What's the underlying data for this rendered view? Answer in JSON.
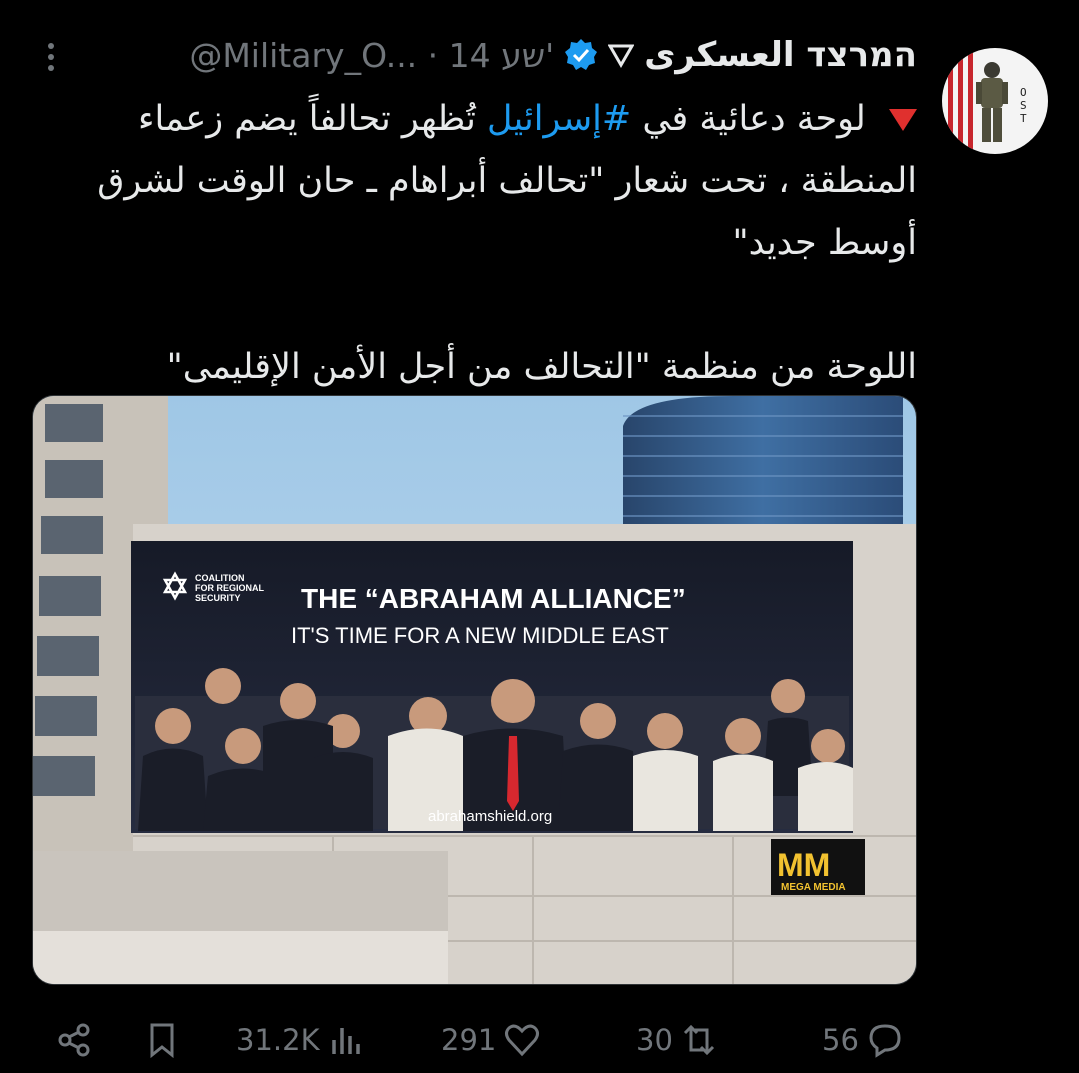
{
  "header": {
    "name": "המרצד العسكرى",
    "handle": "@Military_O... · 14 שע'"
  },
  "tweet": {
    "line1_before": "لوحة دعائية في",
    "hashtag": "#إسرائيل",
    "line1_after": "تُظهر تحالفاً يضم زعماء",
    "line2": "المنطقة ، تحت شعار \"تحالف أبراهام ـ حان الوقت لشرق",
    "line3": "أوسط جديد\"",
    "line5": "اللوحة من منظمة \"التحالف من أجل الأمن الإقليمى\""
  },
  "billboard": {
    "org_line1": "COALITION",
    "org_line2": "FOR REGIONAL",
    "org_line3": "SECURITY",
    "headline": "THE “ABRAHAM ALLIANCE”",
    "subhead": "IT'S TIME FOR A NEW MIDDLE EAST",
    "url": "abrahamshield.org",
    "mm_logo": "MM",
    "mm_text": "MEGA MEDIA"
  },
  "actions": {
    "views": "31.2K",
    "likes": "291",
    "reposts": "30",
    "replies": "56"
  },
  "colors": {
    "accent": "#1d9bf0",
    "muted": "#71767b",
    "billboard_bg": "#1e2233",
    "sky": "#a7cce9"
  },
  "icons": [
    "more-icon",
    "verified-icon",
    "share-icon",
    "bookmark-icon",
    "views-icon",
    "like-icon",
    "repost-icon",
    "reply-icon"
  ]
}
